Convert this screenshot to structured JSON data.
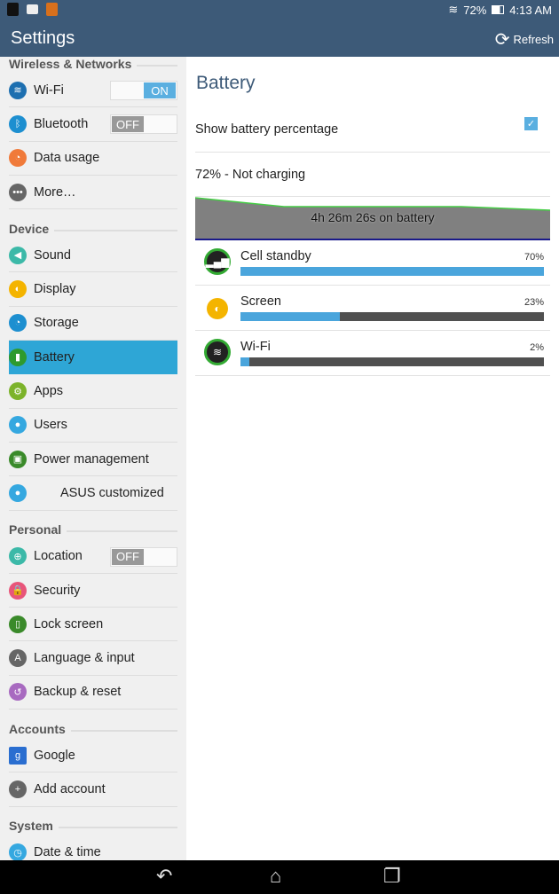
{
  "status": {
    "battery": "72%",
    "time": "4:13 AM",
    "battery_level": 0.72
  },
  "actionbar": {
    "title": "Settings",
    "refresh": "Refresh"
  },
  "sidebar": [
    {
      "type": "header",
      "label": "Wireless & Networks"
    },
    {
      "type": "item",
      "label": "Wi-Fi",
      "icon": "wifi-icon",
      "color": "#1d6fb0",
      "glyph": "≋",
      "toggle": "ON"
    },
    {
      "type": "item",
      "label": "Bluetooth",
      "icon": "bluetooth-icon",
      "color": "#1d8fd0",
      "glyph": "ᛒ",
      "toggle": "OFF"
    },
    {
      "type": "item",
      "label": "Data usage",
      "icon": "data-usage-icon",
      "color": "#f07a3a",
      "glyph": "◔"
    },
    {
      "type": "item",
      "label": "More…",
      "icon": "more-icon",
      "color": "#666",
      "glyph": "•••"
    },
    {
      "type": "header",
      "label": "Device"
    },
    {
      "type": "item",
      "label": "Sound",
      "icon": "sound-icon",
      "color": "#3cb9a8",
      "glyph": "◀"
    },
    {
      "type": "item",
      "label": "Display",
      "icon": "display-icon",
      "color": "#f4b400",
      "glyph": "◐"
    },
    {
      "type": "item",
      "label": "Storage",
      "icon": "storage-icon",
      "color": "#1d8fd0",
      "glyph": "◔"
    },
    {
      "type": "item",
      "label": "Battery",
      "icon": "battery-icon",
      "color": "#2e9a2e",
      "glyph": "▮",
      "selected": true
    },
    {
      "type": "item",
      "label": "Apps",
      "icon": "apps-icon",
      "color": "#7cb32a",
      "glyph": "⚙"
    },
    {
      "type": "item",
      "label": "Users",
      "icon": "users-icon",
      "color": "#35a8e0",
      "glyph": "●"
    },
    {
      "type": "item",
      "label": "Power management",
      "icon": "power-management-icon",
      "color": "#3a8a2a",
      "glyph": "▣"
    },
    {
      "type": "item",
      "label": "ASUS customized",
      "icon": "asus-customized-icon",
      "color": "#35a8e0",
      "glyph": "●",
      "indent": true
    },
    {
      "type": "header",
      "label": "Personal"
    },
    {
      "type": "item",
      "label": "Location",
      "icon": "location-icon",
      "color": "#3cb9a8",
      "glyph": "⊕",
      "toggle": "OFF"
    },
    {
      "type": "item",
      "label": "Security",
      "icon": "security-icon",
      "color": "#e8557a",
      "glyph": "🔒"
    },
    {
      "type": "item",
      "label": "Lock screen",
      "icon": "lock-screen-icon",
      "color": "#3a8a2a",
      "glyph": "▯"
    },
    {
      "type": "item",
      "label": "Language & input",
      "icon": "language-icon",
      "color": "#666",
      "glyph": "A"
    },
    {
      "type": "item",
      "label": "Backup & reset",
      "icon": "backup-icon",
      "color": "#a86ac0",
      "glyph": "↺"
    },
    {
      "type": "header",
      "label": "Accounts"
    },
    {
      "type": "item",
      "label": "Google",
      "icon": "google-icon",
      "color": "#2a6ed0",
      "glyph": "g",
      "square": true
    },
    {
      "type": "item",
      "label": "Add account",
      "icon": "add-account-icon",
      "color": "#666",
      "glyph": "+"
    },
    {
      "type": "header",
      "label": "System"
    },
    {
      "type": "item",
      "label": "Date & time",
      "icon": "date-time-icon",
      "color": "#35a8e0",
      "glyph": "◷"
    }
  ],
  "main": {
    "title": "Battery",
    "show_pct_label": "Show battery percentage",
    "show_pct_checked": true,
    "status": "72% - Not charging",
    "graph_label": "4h 26m 26s on battery",
    "usage": [
      {
        "name": "Cell standby",
        "pct": "70%",
        "value": 70,
        "icon": "cell-standby-icon",
        "glyph": "▂▄▆"
      },
      {
        "name": "Screen",
        "pct": "23%",
        "value": 23,
        "icon": "screen-icon",
        "glyph": "◐"
      },
      {
        "name": "Wi-Fi",
        "pct": "2%",
        "value": 2,
        "icon": "wifi-usage-icon",
        "glyph": "≋"
      }
    ]
  },
  "navbar": {
    "back": "back-icon",
    "home": "home-icon",
    "recents": "recents-icon"
  }
}
